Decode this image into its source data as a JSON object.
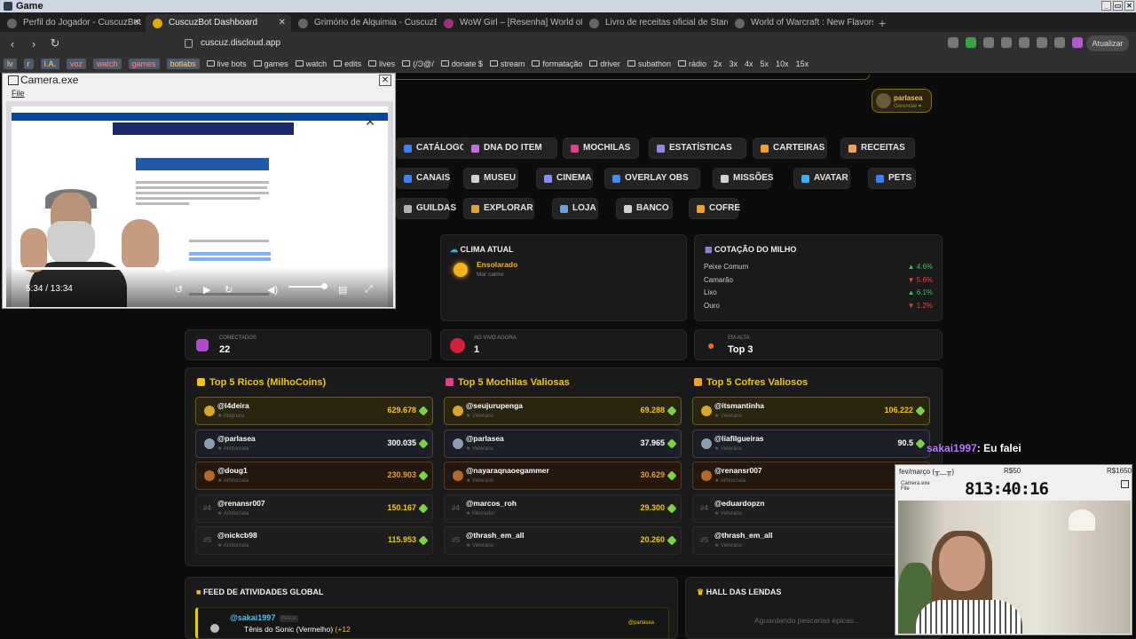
{
  "obs": {
    "title": "Game",
    "win_controls": [
      "_",
      "▭",
      "✕"
    ]
  },
  "tabs": [
    {
      "label": "Perfil do Jogador - CuscuzBot"
    },
    {
      "label": "CuscuzBot Dashboard"
    },
    {
      "label": "Grimório de Alquimia - CuscuzBot"
    },
    {
      "label": "WoW Girl – [Resenha] World of Warcraft"
    },
    {
      "label": "Livro de receitas oficial de Stardew Valley"
    },
    {
      "label": "World of Warcraft : New Flavors of Azeroth"
    }
  ],
  "address": {
    "url": "cuscuz.discloud.app",
    "update_label": "Atualizar"
  },
  "bookmarks": [
    "lv",
    "r",
    "I.A.",
    "voz",
    "watch",
    "games",
    "botlabs",
    "live bots",
    "games",
    "watch",
    "edits",
    "lives",
    "(/Ͽ@/",
    "donate $",
    "stream",
    "formatação",
    "driver",
    "subathon",
    "rádio",
    "2x",
    "3x",
    "4x",
    "5x",
    "10x",
    "15x"
  ],
  "user": {
    "name": "parlasea",
    "sub": "Gerenciar ▾"
  },
  "nav_buttons": [
    {
      "label": "CATÁLOGO",
      "color": "#3a82f6"
    },
    {
      "label": "DNA DO ITEM",
      "color": "#c070e0"
    },
    {
      "label": "MOCHILAS",
      "color": "#e0408a"
    },
    {
      "label": "ESTATÍSTICAS",
      "color": "#9a86e0"
    },
    {
      "label": "CARTEIRAS",
      "color": "#f0a030"
    },
    {
      "label": "RECEITAS",
      "color": "#f0a060"
    },
    {
      "label": "CANAIS",
      "color": "#3a82f6"
    },
    {
      "label": "MUSEU",
      "color": "#d0d0d0"
    },
    {
      "label": "CINEMA",
      "color": "#8a8aff"
    },
    {
      "label": "OVERLAY OBS",
      "color": "#4a8af0"
    },
    {
      "label": "MISSÕES",
      "color": "#d0d0d0"
    },
    {
      "label": "AVATAR",
      "color": "#3ab0f0"
    },
    {
      "label": "PETS",
      "color": "#3a82f6"
    },
    {
      "label": "GUILDAS",
      "color": "#b0b0b0"
    },
    {
      "label": "EXPLORAR",
      "color": "#e0a040"
    },
    {
      "label": "LOJA",
      "color": "#6aa0e0"
    },
    {
      "label": "BANCO",
      "color": "#d0d0d0"
    },
    {
      "label": "COFRE",
      "color": "#f0a030"
    }
  ],
  "clima": {
    "title": "CLIMA ATUAL",
    "state": "Ensolarado",
    "sea": "Mar calmo"
  },
  "milho": {
    "title": "COTAÇÃO DO MILHO",
    "rows": [
      {
        "name": "Peixe Comum",
        "dir": "up",
        "value": "4.6%"
      },
      {
        "name": "Camarão",
        "dir": "dn",
        "value": "5.6%"
      },
      {
        "name": "Lixo",
        "dir": "up",
        "value": "6.1%"
      },
      {
        "name": "Ouro",
        "dir": "dn",
        "value": "1.2%"
      }
    ]
  },
  "stats": [
    {
      "label": "CONECTADOS",
      "value": "22"
    },
    {
      "label": "AO VIVO AGORA",
      "value": "1"
    },
    {
      "label": "EM ALTA",
      "value": "Top 3"
    }
  ],
  "rankings": [
    {
      "title": "Top 5 Ricos (MilhoCoins)",
      "rows": [
        {
          "user": "@l4deira",
          "role": "Magnata",
          "value": "629.678"
        },
        {
          "user": "@parlasea",
          "role": "Aristocrata",
          "value": "300.035"
        },
        {
          "user": "@doug1",
          "role": "Aristocrata",
          "value": "230.903"
        },
        {
          "user": "@renansr007",
          "role": "Aristocrata",
          "value": "150.167",
          "rank": "#4"
        },
        {
          "user": "@nickcb98",
          "role": "Aristocrata",
          "value": "115.953",
          "rank": "#5"
        }
      ]
    },
    {
      "title": "Top 5 Mochilas Valiosas",
      "rows": [
        {
          "user": "@seujurupenga",
          "role": "Veterano",
          "value": "69.288"
        },
        {
          "user": "@parlasea",
          "role": "Veterano",
          "value": "37.965"
        },
        {
          "user": "@nayaraqnaoegammer",
          "role": "Veterano",
          "value": "30.629"
        },
        {
          "user": "@marcos_roh",
          "role": "Mercador",
          "value": "29.300",
          "rank": "#4"
        },
        {
          "user": "@thrash_em_all",
          "role": "Veterano",
          "value": "20.260",
          "rank": "#5"
        }
      ]
    },
    {
      "title": "Top 5 Cofres Valiosos",
      "rows": [
        {
          "user": "@itsmantinha",
          "role": "Veterano",
          "value": "106.222"
        },
        {
          "user": "@liafilgueiras",
          "role": "Veterano",
          "value": "90.5"
        },
        {
          "user": "@renansr007",
          "role": "Aristocrata",
          "value": ""
        },
        {
          "user": "@eduardopzn",
          "role": "Veterano",
          "value": "",
          "rank": "#4"
        },
        {
          "user": "@thrash_em_all",
          "role": "Veterano",
          "value": "",
          "rank": "#5"
        }
      ]
    }
  ],
  "feed": {
    "title": "FEED DE ATIVIDADES GLOBAL",
    "entry": {
      "user": "@sakai1997",
      "tag": "PESCA",
      "item": "Tênis do Sonic (Vermelho)",
      "bonus": "(+12",
      "right": "@parlasea"
    }
  },
  "hall": {
    "title": "HALL DAS LENDAS",
    "waiting": "Aguardando pescarias épicas..."
  },
  "camera": {
    "title": "Camera.exe",
    "menu": "File",
    "time": "5:34 / 13:34",
    "progress": 0.415
  },
  "camera2": {
    "header_left": "fev/março (╥﹏╥)",
    "header_mid": "R$50",
    "header_right": "R$1650",
    "clock": "813:40:16",
    "small": "Camera.exe\nFile"
  },
  "chat": {
    "user": "sakai1997",
    "msg": ": Eu falei"
  }
}
